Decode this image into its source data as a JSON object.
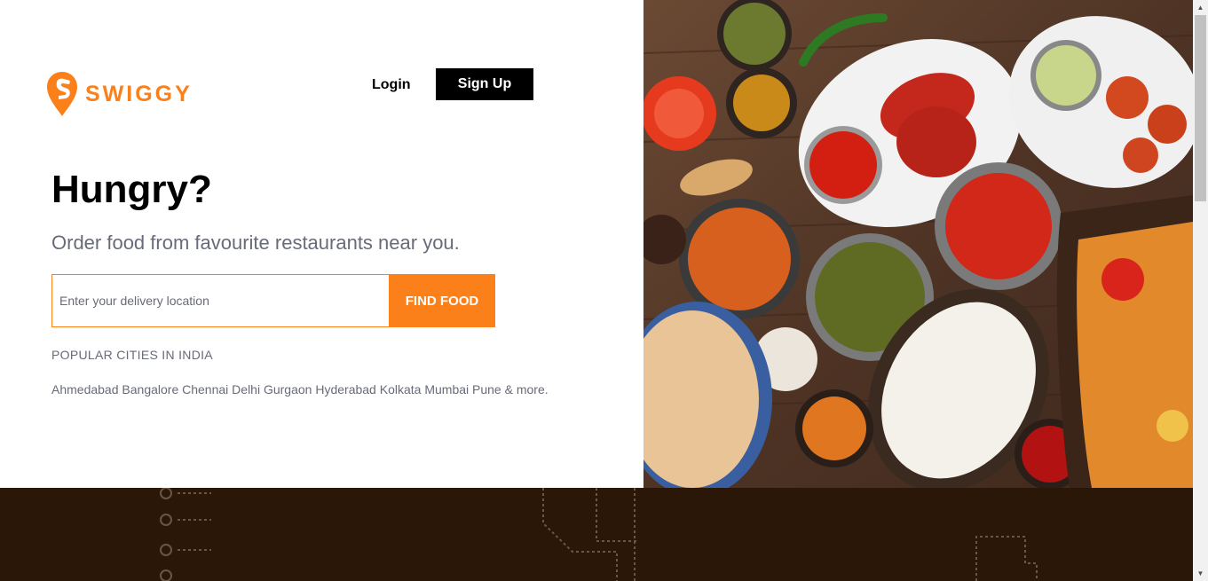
{
  "brand": {
    "name": "SWIGGY",
    "accent": "#fc8019"
  },
  "header": {
    "login_label": "Login",
    "signup_label": "Sign Up"
  },
  "hero": {
    "headline": "Hungry?",
    "subheadline": "Order food from favourite restaurants near you.",
    "search": {
      "placeholder": "Enter your delivery location",
      "value": "",
      "button_label": "FIND FOOD"
    },
    "popular_title": "POPULAR CITIES IN INDIA",
    "cities": [
      "Ahmedabad",
      "Bangalore",
      "Chennai",
      "Delhi",
      "Gurgaon",
      "Hyderabad",
      "Kolkata",
      "Mumbai",
      "Pune"
    ],
    "cities_suffix": "& more."
  },
  "icons": {
    "logo": "swiggy-pin-logo-icon",
    "scroll_up": "triangle-up-icon",
    "scroll_down": "triangle-down-icon"
  }
}
